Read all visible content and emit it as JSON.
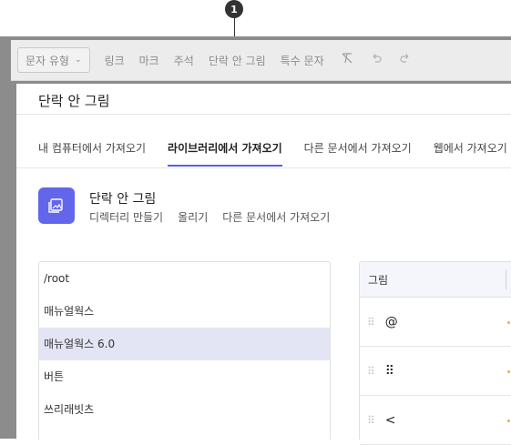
{
  "callout": {
    "number": "1"
  },
  "toolbar": {
    "select_label": "문자 유형",
    "items": [
      "링크",
      "마크",
      "주석",
      "단락 안 그림",
      "특수 문자"
    ],
    "icons": [
      "clear-format-icon",
      "undo-icon",
      "redo-icon"
    ]
  },
  "dialog": {
    "title": "단락 안 그림",
    "tabs": [
      "내 컴퓨터에서 가져오기",
      "라이브러리에서 가져오기",
      "다른 문서에서 가져오기",
      "웹에서 가져오기"
    ],
    "active_tab": 1,
    "library": {
      "title": "단락 안 그림",
      "actions": [
        "디렉터리 만들기",
        "올리기",
        "다른 문서에서 가져오기"
      ],
      "icon": "image-icon",
      "accent": "#6366ea"
    },
    "tree": {
      "items": [
        "/root",
        "매뉴얼웍스",
        "매뉴얼웍스 6.0",
        "버튼",
        "쓰리래빗츠"
      ],
      "selected_index": 2
    },
    "grid": {
      "header": "그림",
      "rows": [
        {
          "icon": "at-sign-icon",
          "glyph": "@"
        },
        {
          "icon": "grid-dots-icon",
          "glyph": "⠿"
        },
        {
          "icon": "chevron-left-icon",
          "glyph": "<"
        }
      ]
    }
  }
}
